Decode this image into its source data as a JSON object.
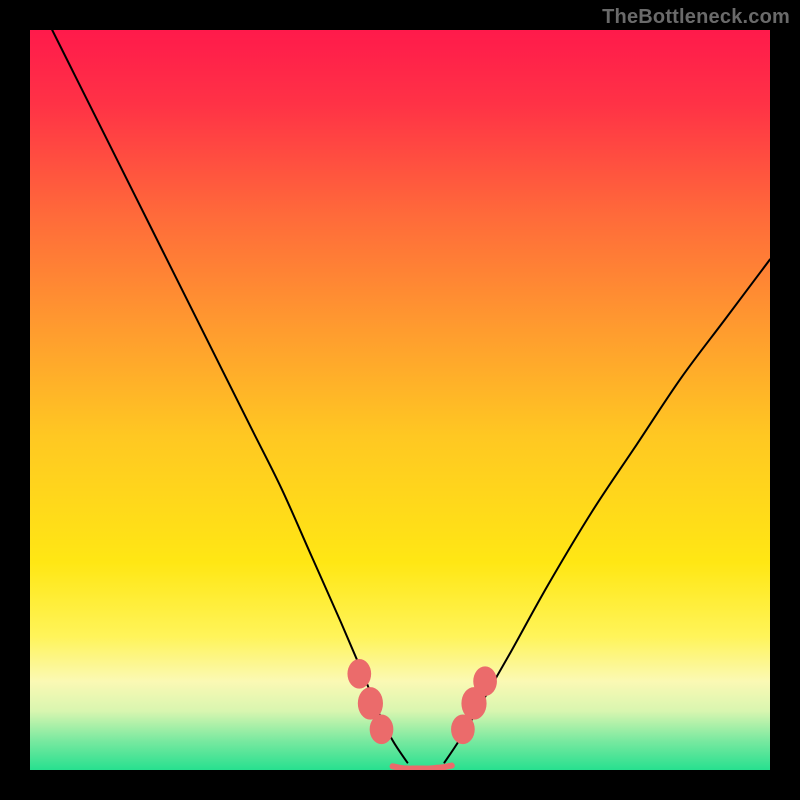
{
  "watermark": "TheBottleneck.com",
  "chart_data": {
    "type": "line",
    "title": "",
    "xlabel": "",
    "ylabel": "",
    "xlim": [
      0,
      100
    ],
    "ylim": [
      0,
      100
    ],
    "grid": false,
    "legend": false,
    "background_gradient": {
      "stops": [
        {
          "offset": 0.0,
          "color": "#ff1a4b"
        },
        {
          "offset": 0.1,
          "color": "#ff3246"
        },
        {
          "offset": 0.25,
          "color": "#ff6a3a"
        },
        {
          "offset": 0.4,
          "color": "#ff9a2f"
        },
        {
          "offset": 0.55,
          "color": "#ffc822"
        },
        {
          "offset": 0.72,
          "color": "#ffe714"
        },
        {
          "offset": 0.82,
          "color": "#fff45a"
        },
        {
          "offset": 0.88,
          "color": "#fbf9b4"
        },
        {
          "offset": 0.92,
          "color": "#d9f6b0"
        },
        {
          "offset": 0.96,
          "color": "#7ae9a0"
        },
        {
          "offset": 1.0,
          "color": "#27e08f"
        }
      ]
    },
    "series": [
      {
        "name": "left-curve",
        "stroke": "#000000",
        "stroke_width": 2,
        "x": [
          3,
          6,
          10,
          14,
          18,
          22,
          26,
          30,
          34,
          38,
          42,
          45,
          47,
          49,
          51
        ],
        "y": [
          100,
          94,
          86,
          78,
          70,
          62,
          54,
          46,
          38,
          29,
          20,
          13,
          8,
          4,
          1
        ]
      },
      {
        "name": "right-curve",
        "stroke": "#000000",
        "stroke_width": 2,
        "x": [
          56,
          58,
          61,
          65,
          70,
          76,
          82,
          88,
          94,
          100
        ],
        "y": [
          1,
          4,
          9,
          16,
          25,
          35,
          44,
          53,
          61,
          69
        ]
      },
      {
        "name": "flat-bottom",
        "stroke": "#eb6b6b",
        "stroke_width": 6,
        "x": [
          49,
          50,
          51,
          52,
          53,
          54,
          55,
          56,
          57
        ],
        "y": [
          0.5,
          0.3,
          0.2,
          0.2,
          0.2,
          0.2,
          0.3,
          0.4,
          0.6
        ]
      }
    ],
    "markers": [
      {
        "x": 44.5,
        "y": 13.0,
        "rx": 1.6,
        "ry": 2.0,
        "color": "#eb6b6b"
      },
      {
        "x": 46.0,
        "y": 9.0,
        "rx": 1.7,
        "ry": 2.2,
        "color": "#eb6b6b"
      },
      {
        "x": 47.5,
        "y": 5.5,
        "rx": 1.6,
        "ry": 2.0,
        "color": "#eb6b6b"
      },
      {
        "x": 58.5,
        "y": 5.5,
        "rx": 1.6,
        "ry": 2.0,
        "color": "#eb6b6b"
      },
      {
        "x": 60.0,
        "y": 9.0,
        "rx": 1.7,
        "ry": 2.2,
        "color": "#eb6b6b"
      },
      {
        "x": 61.5,
        "y": 12.0,
        "rx": 1.6,
        "ry": 2.0,
        "color": "#eb6b6b"
      }
    ]
  }
}
